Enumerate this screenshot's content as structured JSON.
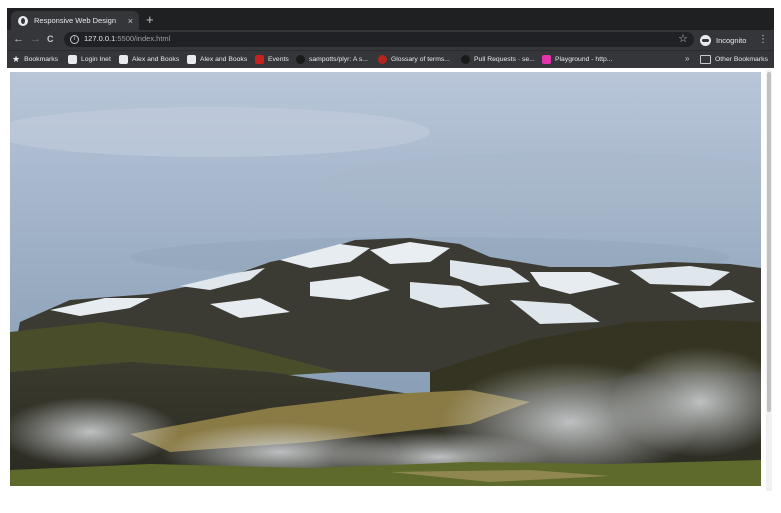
{
  "tab": {
    "title": "Responsive Web Design",
    "close": "×"
  },
  "new_tab": "+",
  "nav": {
    "back": "←",
    "forward": "→",
    "reload": "C"
  },
  "address": {
    "host": "127.0.0.1",
    "rest": ":5500/index.html",
    "info": "i"
  },
  "bookmark_star": "☆",
  "profile": {
    "label": "Incognito"
  },
  "menu": "⋮",
  "bookmarks": {
    "items": [
      {
        "label": "Bookmarks"
      },
      {
        "label": "Login Inet"
      },
      {
        "label": "Alex and Books"
      },
      {
        "label": "Alex and Books"
      },
      {
        "label": "Events"
      },
      {
        "label": "sampotts/plyr: A s..."
      },
      {
        "label": "Glossary of terms..."
      },
      {
        "label": "Pull Requests · se..."
      },
      {
        "label": "Playground - http..."
      }
    ],
    "more": "»",
    "other": "Other Bookmarks"
  },
  "colors": {
    "chrome_dark": "#202124",
    "chrome_bar": "#35363a",
    "sky_top": "#b9c6d9",
    "sky_bottom": "#7f97ad",
    "snow": "#e6ecf0",
    "mountain": "#3c3b33",
    "moss": "#5e6a2b",
    "grass": "#8a7a44"
  }
}
